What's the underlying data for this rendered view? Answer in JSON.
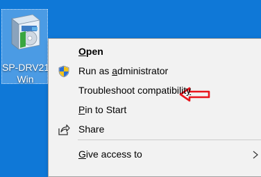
{
  "desktop": {
    "background_color": "#0f78d7",
    "icon": {
      "name": "sp-drv-installer-icon",
      "label_line1": "SP-DRV21",
      "label_line2": "Win"
    }
  },
  "context_menu": {
    "items": [
      {
        "pre": "",
        "u": "O",
        "post": "pen",
        "bold": true
      },
      {
        "pre": "Run as ",
        "u": "a",
        "post": "dministrator",
        "icon": "uac-shield-icon"
      },
      {
        "pre": "Troubleshoot compatibilit",
        "u": "y",
        "post": ""
      },
      {
        "pre": "",
        "u": "P",
        "post": "in to Start"
      },
      {
        "pre": "Share",
        "u": "",
        "post": "",
        "icon": "share-icon"
      },
      {
        "pre": "",
        "u": "G",
        "post": "ive access to",
        "submenu": true,
        "icon": "chevron-right-icon"
      }
    ]
  },
  "annotation": {
    "icon": "red-arrow-icon",
    "color": "#e8141b"
  }
}
